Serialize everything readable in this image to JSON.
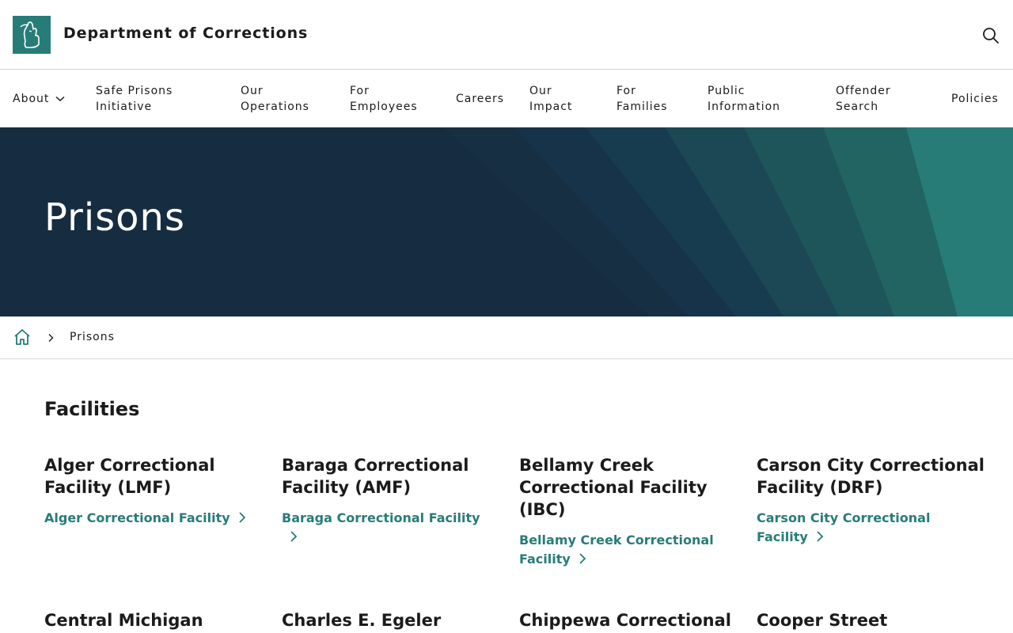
{
  "header": {
    "site_title": "Department of Corrections",
    "logo_icon": "michigan-mitten-logo-icon",
    "search_icon": "search-icon"
  },
  "nav": {
    "items": [
      {
        "label": "About",
        "has_dropdown": true
      },
      {
        "label": "Safe Prisons\nInitiative"
      },
      {
        "label": "Our\nOperations"
      },
      {
        "label": "For\nEmployees"
      },
      {
        "label": "Careers"
      },
      {
        "label": "Our\nImpact"
      },
      {
        "label": "For\nFamilies"
      },
      {
        "label": "Public\nInformation"
      },
      {
        "label": "Offender\nSearch"
      },
      {
        "label": "Policies"
      }
    ]
  },
  "hero": {
    "title": "Prisons"
  },
  "breadcrumb": {
    "home_icon": "home-icon",
    "current": "Prisons"
  },
  "facilities": {
    "heading": "Facilities",
    "cards": [
      {
        "title": "Alger Correctional Facility (LMF)",
        "link": "Alger Correctional Facility"
      },
      {
        "title": "Baraga Correctional Facility (AMF)",
        "link": "Baraga Correctional Facility"
      },
      {
        "title": "Bellamy Creek Correctional Facility (IBC)",
        "link": "Bellamy Creek Correctional Facility"
      },
      {
        "title": "Carson City Correctional Facility (DRF)",
        "link": "Carson City Correctional Facility"
      },
      {
        "title": "Central Michigan",
        "link": ""
      },
      {
        "title": "Charles E. Egeler",
        "link": ""
      },
      {
        "title": "Chippewa Correctional",
        "link": ""
      },
      {
        "title": "Cooper Street",
        "link": ""
      }
    ]
  },
  "colors": {
    "brand_teal": "#277c78",
    "hero_navy": "#162c40",
    "text": "#1b1b1b"
  }
}
